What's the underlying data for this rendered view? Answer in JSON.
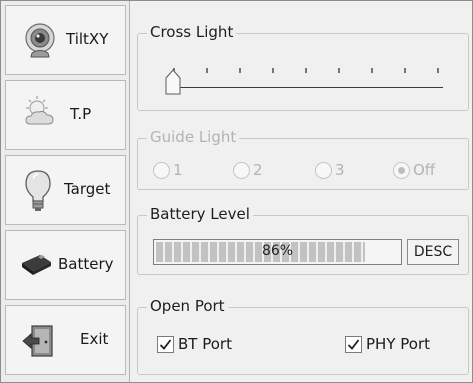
{
  "nav": {
    "items": [
      {
        "label": "TiltXY",
        "icon": "webcam-icon"
      },
      {
        "label": "T.P",
        "icon": "weather-icon"
      },
      {
        "label": "Target",
        "icon": "lightbulb-icon"
      },
      {
        "label": "Battery",
        "icon": "battery-icon"
      },
      {
        "label": "Exit",
        "icon": "exit-door-icon"
      }
    ]
  },
  "cross_light": {
    "title": "Cross Light",
    "slider_value": 0
  },
  "guide_light": {
    "title": "Guide Light",
    "options": [
      "1",
      "2",
      "3",
      "Off"
    ],
    "selected": "Off",
    "enabled": false
  },
  "battery_level": {
    "title": "Battery Level",
    "value_text": "86%",
    "value": 0.86,
    "desc_label": "DESC"
  },
  "open_port": {
    "title": "Open Port",
    "bt_label": "BT Port",
    "bt_checked": true,
    "phy_label": "PHY Port",
    "phy_checked": true
  },
  "colors": {
    "background": "#f0f0f0",
    "disabled_text": "#b3b3b3",
    "progress_fill": "#c2c2c2"
  }
}
